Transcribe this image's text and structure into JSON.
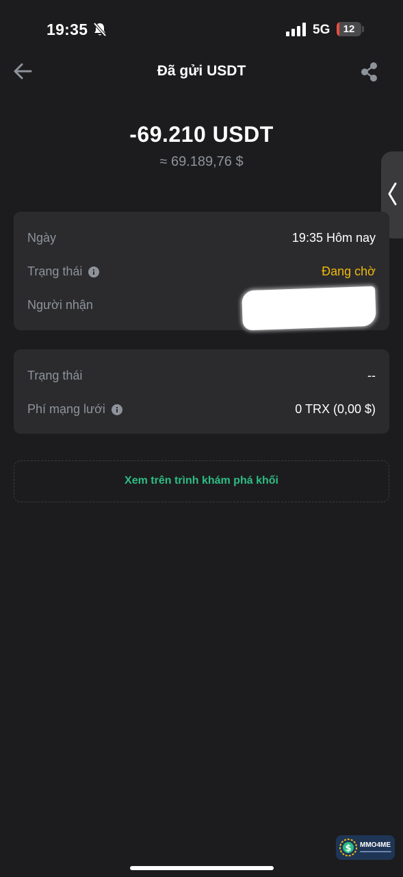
{
  "status_bar": {
    "time": "19:35",
    "network": "5G",
    "battery_level": "12",
    "icons": [
      "bell-slash-icon",
      "signal-icon",
      "battery-icon"
    ]
  },
  "nav": {
    "title": "Đã gửi USDT",
    "back_icon": "arrow-left-icon",
    "share_icon": "share-icon"
  },
  "transaction": {
    "amount": "-69.210 USDT",
    "fiat_amount": "≈ 69.189,76 $"
  },
  "details": {
    "date_label": "Ngày",
    "date_value": "19:35 Hôm nay",
    "status_label": "Trạng thái",
    "status_value": "Đang chờ",
    "recipient_label": "Người nhận"
  },
  "network_info": {
    "status_label": "Trạng thái",
    "status_value": "--",
    "fee_label": "Phí mạng lưới",
    "fee_value": "0 TRX (0,00 $)"
  },
  "explorer_link": "Xem trên trình khám phá khối",
  "watermark": {
    "text": "MMO4ME"
  },
  "colors": {
    "background": "#1c1c1e",
    "card": "#2b2b2e",
    "label": "#8e939b",
    "pending": "#f0b90b",
    "link": "#2ebd85"
  }
}
